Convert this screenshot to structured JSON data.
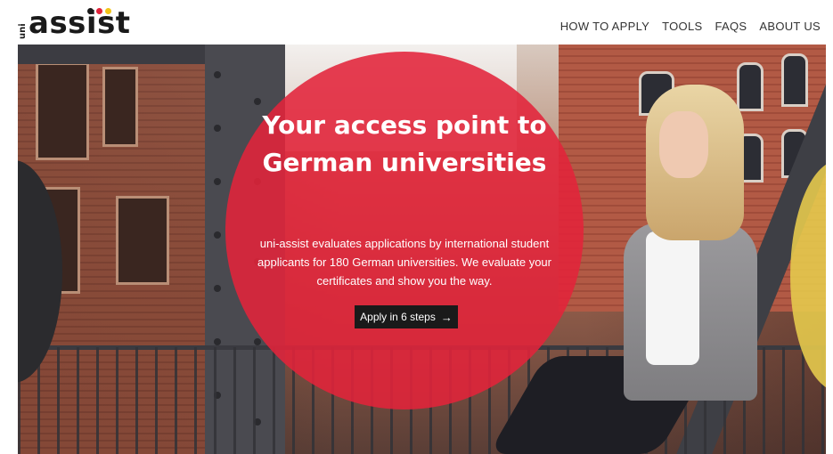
{
  "brand": {
    "logo_prefix": "uni",
    "logo_text": "assist",
    "dot_colors": [
      "#1a1a1a",
      "#e2233a",
      "#f2c418"
    ]
  },
  "nav": {
    "items": [
      {
        "label": "HOW TO APPLY"
      },
      {
        "label": "TOOLS"
      },
      {
        "label": "FAQS"
      },
      {
        "label": "ABOUT US"
      }
    ]
  },
  "hero": {
    "headline": "Your access point to German universities",
    "description": "uni-assist evaluates applications by international student applicants for 180 German universities. We evaluate your certificates and show you the way.",
    "cta_label": "Apply in 6 steps",
    "cta_icon": "arrow-right-icon",
    "accent_color": "#e2233a"
  }
}
